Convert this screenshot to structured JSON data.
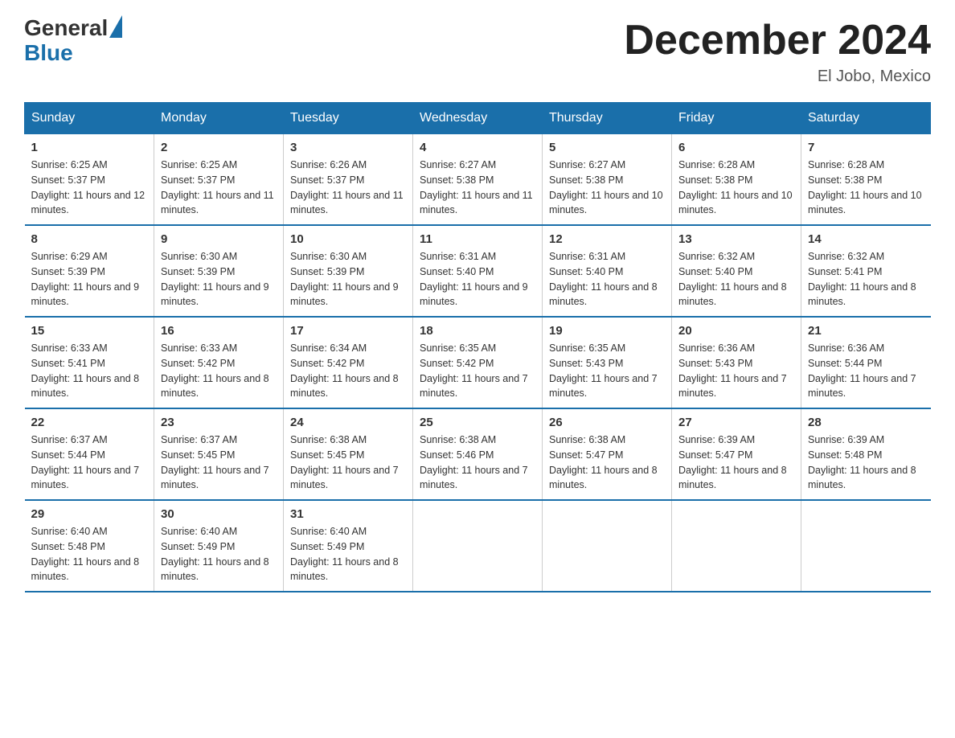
{
  "header": {
    "logo_general": "General",
    "logo_blue": "Blue",
    "month_title": "December 2024",
    "location": "El Jobo, Mexico"
  },
  "days_of_week": [
    "Sunday",
    "Monday",
    "Tuesday",
    "Wednesday",
    "Thursday",
    "Friday",
    "Saturday"
  ],
  "weeks": [
    [
      {
        "day": "1",
        "sunrise": "6:25 AM",
        "sunset": "5:37 PM",
        "daylight": "11 hours and 12 minutes."
      },
      {
        "day": "2",
        "sunrise": "6:25 AM",
        "sunset": "5:37 PM",
        "daylight": "11 hours and 11 minutes."
      },
      {
        "day": "3",
        "sunrise": "6:26 AM",
        "sunset": "5:37 PM",
        "daylight": "11 hours and 11 minutes."
      },
      {
        "day": "4",
        "sunrise": "6:27 AM",
        "sunset": "5:38 PM",
        "daylight": "11 hours and 11 minutes."
      },
      {
        "day": "5",
        "sunrise": "6:27 AM",
        "sunset": "5:38 PM",
        "daylight": "11 hours and 10 minutes."
      },
      {
        "day": "6",
        "sunrise": "6:28 AM",
        "sunset": "5:38 PM",
        "daylight": "11 hours and 10 minutes."
      },
      {
        "day": "7",
        "sunrise": "6:28 AM",
        "sunset": "5:38 PM",
        "daylight": "11 hours and 10 minutes."
      }
    ],
    [
      {
        "day": "8",
        "sunrise": "6:29 AM",
        "sunset": "5:39 PM",
        "daylight": "11 hours and 9 minutes."
      },
      {
        "day": "9",
        "sunrise": "6:30 AM",
        "sunset": "5:39 PM",
        "daylight": "11 hours and 9 minutes."
      },
      {
        "day": "10",
        "sunrise": "6:30 AM",
        "sunset": "5:39 PM",
        "daylight": "11 hours and 9 minutes."
      },
      {
        "day": "11",
        "sunrise": "6:31 AM",
        "sunset": "5:40 PM",
        "daylight": "11 hours and 9 minutes."
      },
      {
        "day": "12",
        "sunrise": "6:31 AM",
        "sunset": "5:40 PM",
        "daylight": "11 hours and 8 minutes."
      },
      {
        "day": "13",
        "sunrise": "6:32 AM",
        "sunset": "5:40 PM",
        "daylight": "11 hours and 8 minutes."
      },
      {
        "day": "14",
        "sunrise": "6:32 AM",
        "sunset": "5:41 PM",
        "daylight": "11 hours and 8 minutes."
      }
    ],
    [
      {
        "day": "15",
        "sunrise": "6:33 AM",
        "sunset": "5:41 PM",
        "daylight": "11 hours and 8 minutes."
      },
      {
        "day": "16",
        "sunrise": "6:33 AM",
        "sunset": "5:42 PM",
        "daylight": "11 hours and 8 minutes."
      },
      {
        "day": "17",
        "sunrise": "6:34 AM",
        "sunset": "5:42 PM",
        "daylight": "11 hours and 8 minutes."
      },
      {
        "day": "18",
        "sunrise": "6:35 AM",
        "sunset": "5:42 PM",
        "daylight": "11 hours and 7 minutes."
      },
      {
        "day": "19",
        "sunrise": "6:35 AM",
        "sunset": "5:43 PM",
        "daylight": "11 hours and 7 minutes."
      },
      {
        "day": "20",
        "sunrise": "6:36 AM",
        "sunset": "5:43 PM",
        "daylight": "11 hours and 7 minutes."
      },
      {
        "day": "21",
        "sunrise": "6:36 AM",
        "sunset": "5:44 PM",
        "daylight": "11 hours and 7 minutes."
      }
    ],
    [
      {
        "day": "22",
        "sunrise": "6:37 AM",
        "sunset": "5:44 PM",
        "daylight": "11 hours and 7 minutes."
      },
      {
        "day": "23",
        "sunrise": "6:37 AM",
        "sunset": "5:45 PM",
        "daylight": "11 hours and 7 minutes."
      },
      {
        "day": "24",
        "sunrise": "6:38 AM",
        "sunset": "5:45 PM",
        "daylight": "11 hours and 7 minutes."
      },
      {
        "day": "25",
        "sunrise": "6:38 AM",
        "sunset": "5:46 PM",
        "daylight": "11 hours and 7 minutes."
      },
      {
        "day": "26",
        "sunrise": "6:38 AM",
        "sunset": "5:47 PM",
        "daylight": "11 hours and 8 minutes."
      },
      {
        "day": "27",
        "sunrise": "6:39 AM",
        "sunset": "5:47 PM",
        "daylight": "11 hours and 8 minutes."
      },
      {
        "day": "28",
        "sunrise": "6:39 AM",
        "sunset": "5:48 PM",
        "daylight": "11 hours and 8 minutes."
      }
    ],
    [
      {
        "day": "29",
        "sunrise": "6:40 AM",
        "sunset": "5:48 PM",
        "daylight": "11 hours and 8 minutes."
      },
      {
        "day": "30",
        "sunrise": "6:40 AM",
        "sunset": "5:49 PM",
        "daylight": "11 hours and 8 minutes."
      },
      {
        "day": "31",
        "sunrise": "6:40 AM",
        "sunset": "5:49 PM",
        "daylight": "11 hours and 8 minutes."
      },
      null,
      null,
      null,
      null
    ]
  ]
}
